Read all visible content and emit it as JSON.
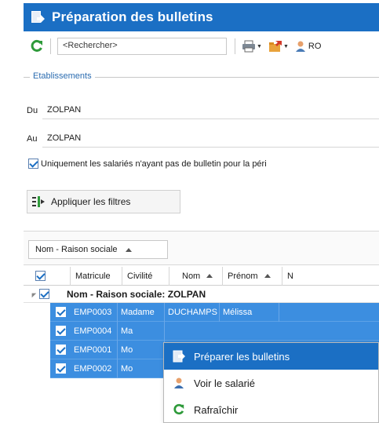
{
  "window": {
    "title": "Préparation des bulletins"
  },
  "toolbar": {
    "search_placeholder": "<Rechercher>",
    "ro_label": "RO"
  },
  "etablissements": {
    "legend": "Etablissements",
    "du_label": "Du",
    "du_value": "ZOLPAN",
    "au_label": "Au",
    "au_value": "ZOLPAN"
  },
  "filter": {
    "checkbox_label": "Uniquement les salariés n'ayant pas de bulletin pour la péri",
    "checked": true
  },
  "apply_button": {
    "label": "Appliquer les filtres"
  },
  "grouping": {
    "chip_label": "Nom - Raison sociale"
  },
  "grid": {
    "columns": [
      "Matricule",
      "Civilité",
      "Nom",
      "Prénom",
      "N"
    ],
    "group_label": "Nom - Raison sociale: ZOLPAN",
    "rows": [
      {
        "matricule": "EMP0003",
        "civilite": "Madame",
        "nom": "DUCHAMPS",
        "prenom": "Mélissa"
      },
      {
        "matricule": "EMP0004",
        "civilite": "Ma",
        "nom": "",
        "prenom": ""
      },
      {
        "matricule": "EMP0001",
        "civilite": "Mo",
        "nom": "",
        "prenom": ""
      },
      {
        "matricule": "EMP0002",
        "civilite": "Mo",
        "nom": "",
        "prenom": ""
      }
    ]
  },
  "context_menu": {
    "items": [
      {
        "label": "Préparer les bulletins",
        "icon": "prepare-bulletins-icon",
        "highlighted": true
      },
      {
        "label": "Voir le salarié",
        "icon": "person-icon",
        "highlighted": false
      },
      {
        "label": "Rafraîchir",
        "icon": "refresh-icon",
        "highlighted": false
      }
    ]
  },
  "colors": {
    "title_bar": "#1b6fc4",
    "selection": "#3c8ee0",
    "menu_highlight": "#1b6fc4",
    "refresh_green": "#2e9a3a"
  }
}
